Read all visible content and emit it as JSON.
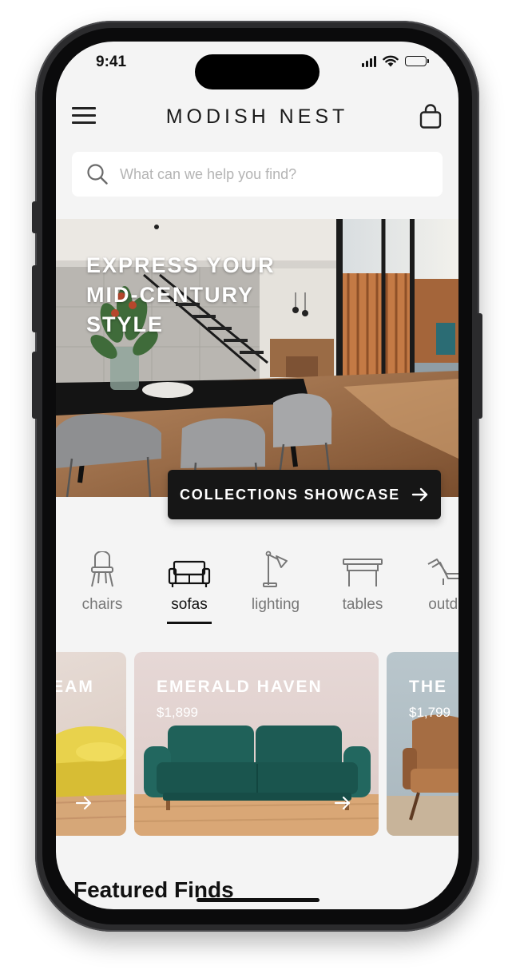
{
  "status_bar": {
    "time": "9:41"
  },
  "header": {
    "brand": "MODISH NEST"
  },
  "search": {
    "placeholder": "What can we help you find?"
  },
  "hero": {
    "title": "EXPRESS YOUR\nMID-CENTURY\nSTYLE",
    "cta": "COLLECTIONS SHOWCASE"
  },
  "categories": [
    {
      "label": "chairs",
      "icon": "chair-icon"
    },
    {
      "label": "sofas",
      "icon": "sofa-icon",
      "active": true
    },
    {
      "label": "lighting",
      "icon": "lamp-icon"
    },
    {
      "label": "tables",
      "icon": "table-icon"
    },
    {
      "label": "outdo",
      "icon": "lounger-icon"
    }
  ],
  "products": [
    {
      "title": "REAM",
      "color": "#e6d44a"
    },
    {
      "title": "EMERALD HAVEN",
      "price": "$1,899",
      "color": "#1f5e57"
    },
    {
      "title": "THE",
      "price": "$1,799",
      "color": "#9a6a44"
    }
  ],
  "sections": {
    "featured_title": "Featured Finds"
  },
  "colors": {
    "accent": "#161616",
    "background": "#f4f4f4",
    "text": "#1a1a1a",
    "muted": "#777777"
  }
}
